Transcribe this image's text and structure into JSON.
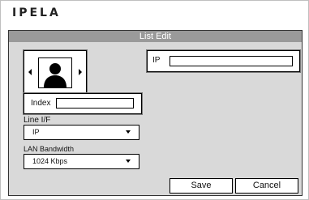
{
  "logo": "IPELA",
  "dialog": {
    "title": "List Edit",
    "ip_label": "IP",
    "ip_value": "",
    "index_label": "Index",
    "index_value": "",
    "line_if_label": "Line I/F",
    "line_if_value": "IP",
    "lan_bw_label": "LAN Bandwidth",
    "lan_bw_value": "1024 Kbps",
    "save_label": "Save",
    "cancel_label": "Cancel"
  },
  "icons": [
    "arrow-left-icon",
    "person-icon",
    "arrow-right-icon",
    "dropdown-caret-icon"
  ]
}
